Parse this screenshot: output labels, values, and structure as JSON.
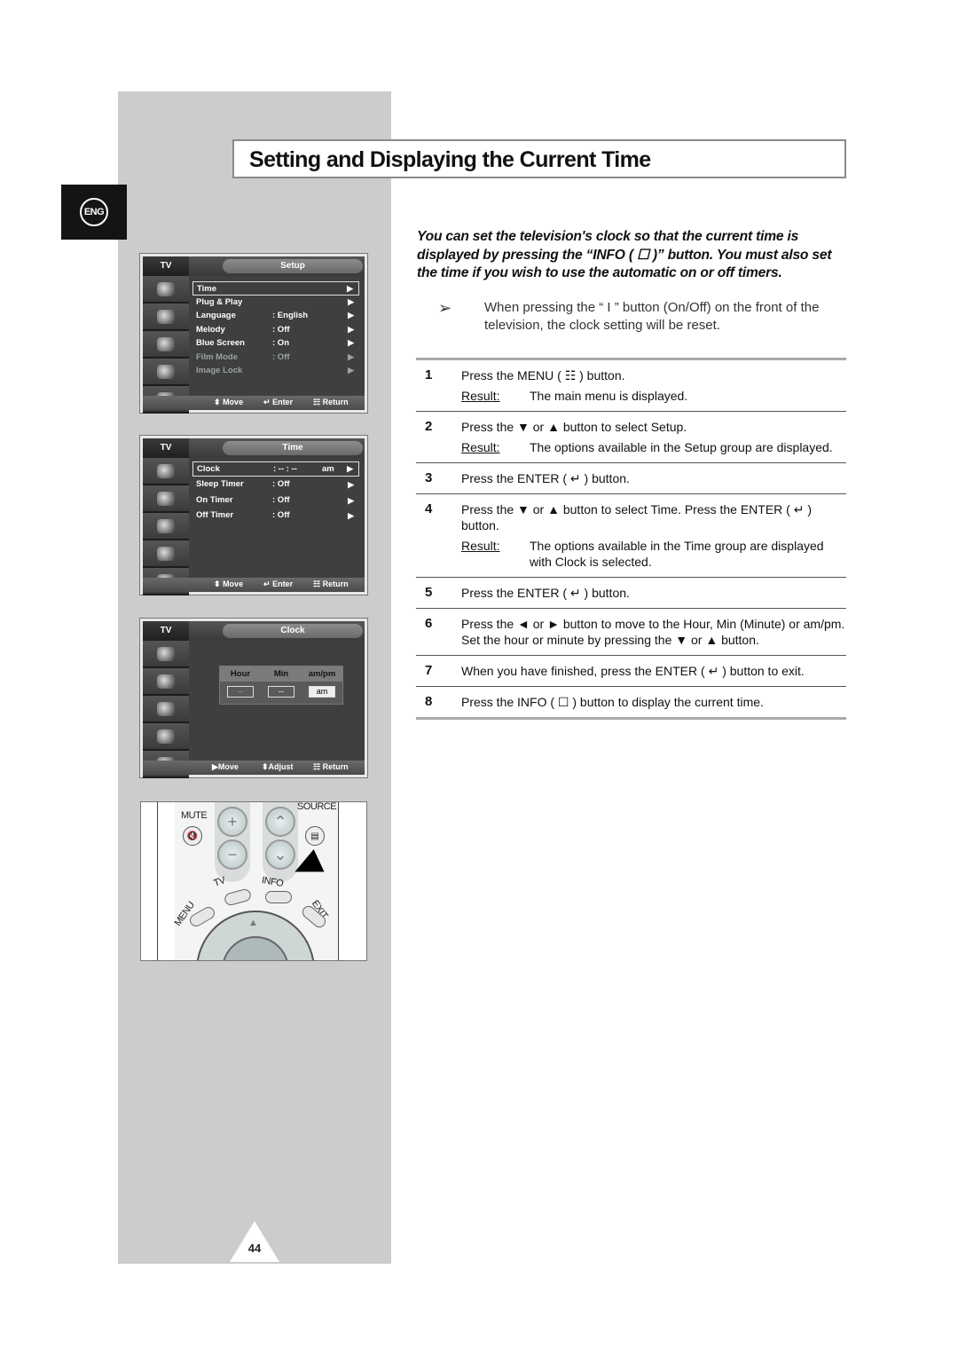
{
  "page": {
    "title": "Setting and Displaying the Current Time",
    "language_badge": "ENG",
    "page_number": "44"
  },
  "osd_screens": [
    {
      "tv_label": "TV",
      "title": "Setup",
      "rows": [
        {
          "label": "Time",
          "value": "",
          "selected": true,
          "dim": false
        },
        {
          "label": "Plug & Play",
          "value": "",
          "selected": false,
          "dim": false
        },
        {
          "label": "Language",
          "value": ": English",
          "selected": false,
          "dim": false
        },
        {
          "label": "Melody",
          "value": ": Off",
          "selected": false,
          "dim": false
        },
        {
          "label": "Blue Screen",
          "value": ": On",
          "selected": false,
          "dim": false
        },
        {
          "label": "Film Mode",
          "value": ": Off",
          "selected": false,
          "dim": true
        },
        {
          "label": "Image Lock",
          "value": "",
          "selected": false,
          "dim": true
        }
      ],
      "hints": {
        "move": "Move",
        "enter": "Enter",
        "return": "Return"
      }
    },
    {
      "tv_label": "TV",
      "title": "Time",
      "rows": [
        {
          "label": "Clock",
          "value": ": -- : --",
          "extra": "am",
          "selected": true
        },
        {
          "label": "Sleep Timer",
          "value": ":  Off",
          "selected": false
        },
        {
          "label": "On Timer",
          "value": ":  Off",
          "selected": false
        },
        {
          "label": "Off Timer",
          "value": ":  Off",
          "selected": false
        }
      ],
      "hints": {
        "move": "Move",
        "enter": "Enter",
        "return": "Return"
      }
    },
    {
      "tv_label": "TV",
      "title": "Clock",
      "clock": {
        "headers": [
          "Hour",
          "Min",
          "am/pm"
        ],
        "hour": "--",
        "min": "--",
        "ampm": "am"
      },
      "hints": {
        "move": "Move",
        "adjust": "Adjust",
        "return": "Return"
      }
    }
  ],
  "remote": {
    "mute": "MUTE",
    "source": "SOURCE",
    "tv": "TV",
    "info": "INFO",
    "menu": "MENU",
    "exit": "EXIT"
  },
  "intro": "You can set the television's clock so that the current time is displayed by pressing the “INFO ( ☐ )” button. You must also set the time if you wish to use the automatic on or off timers.",
  "note": "When pressing the “ I ” button (On/Off) on the front of the television, the clock setting will be reset.",
  "steps": [
    {
      "num": "1",
      "text": "Press the MENU ( ☷ ) button.",
      "result_label": "Result:",
      "result": "The main menu is displayed."
    },
    {
      "num": "2",
      "text": "Press the ▼ or ▲ button to select Setup.",
      "result_label": "Result:",
      "result": "The options available in the Setup group are displayed."
    },
    {
      "num": "3",
      "text": "Press the ENTER ( ↵ ) button."
    },
    {
      "num": "4",
      "text": "Press the ▼ or ▲ button to select Time. Press the ENTER ( ↵ ) button.",
      "result_label": "Result:",
      "result": "The options available in the Time group are displayed with Clock is selected."
    },
    {
      "num": "5",
      "text": "Press the ENTER ( ↵ ) button."
    },
    {
      "num": "6",
      "text": "Press the ◄ or ► button to move to the Hour, Min (Minute) or am/pm. Set the hour or minute by pressing the ▼ or ▲ button."
    },
    {
      "num": "7",
      "text": "When you have finished, press the ENTER ( ↵ ) button to exit."
    },
    {
      "num": "8",
      "text": "Press the INFO ( ☐ ) button to display the current time."
    }
  ]
}
